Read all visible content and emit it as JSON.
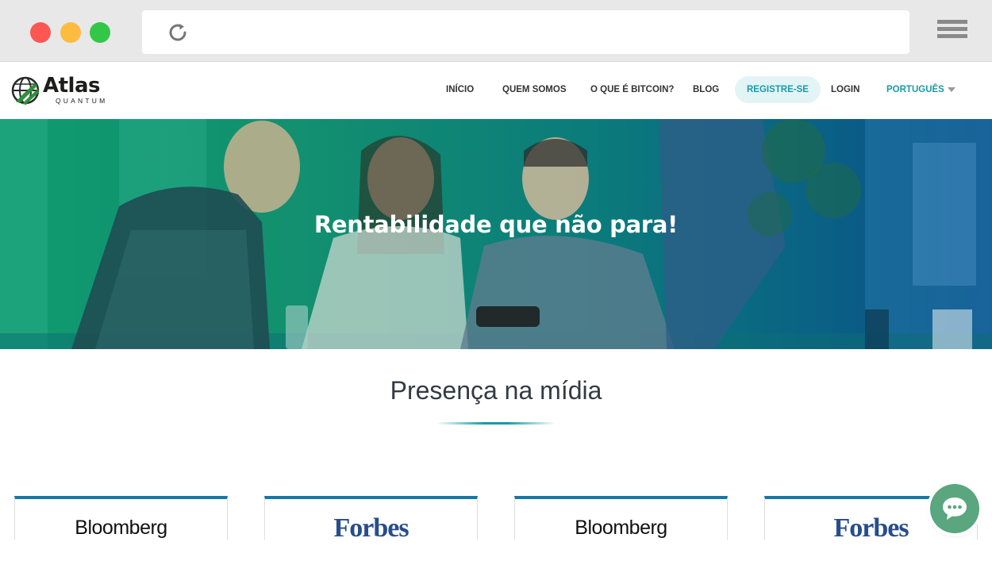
{
  "browser": {
    "reload_icon": "reload-icon",
    "menu_icon": "hamburger-menu-icon"
  },
  "header": {
    "logo_word": "Atlas",
    "logo_sub": "QUANTUM",
    "nav": {
      "inicio": "INÍCIO",
      "quem_somos": "QUEM SOMOS",
      "bitcoin": "O QUE É BITCOIN?",
      "blog": "BLOG",
      "register": "REGISTRE-SE",
      "login": "LOGIN",
      "language": "PORTUGUÊS"
    },
    "accent_color": "#1a9aa6"
  },
  "hero": {
    "title": "Rentabilidade que não para!"
  },
  "media": {
    "title": "Presença na mídia",
    "cards": [
      "Bloomberg",
      "Forbes",
      "Bloomberg",
      "Forbes"
    ]
  },
  "chat": {
    "icon": "chat-bubble-icon",
    "color": "#5aa67f"
  }
}
